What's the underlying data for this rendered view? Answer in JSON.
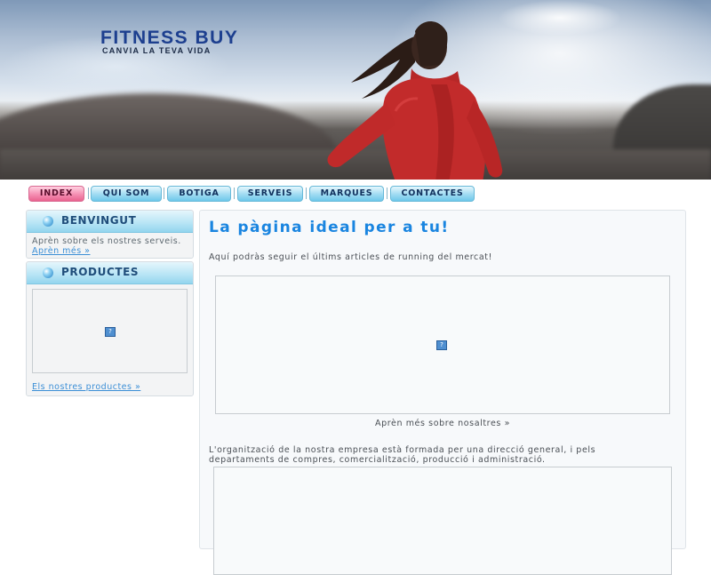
{
  "brand": {
    "title": "FITNESS BUY",
    "tagline": "CANVIA LA TEVA VIDA"
  },
  "nav": {
    "items": [
      {
        "label": "INDEX",
        "active": true
      },
      {
        "label": "QUI SOM",
        "active": false
      },
      {
        "label": "BOTIGA",
        "active": false
      },
      {
        "label": "SERVEIS",
        "active": false
      },
      {
        "label": "MARQUES",
        "active": false
      },
      {
        "label": "CONTACTES",
        "active": false
      }
    ]
  },
  "sidebar": {
    "welcome": {
      "title": "BENVINGUT",
      "text": "Aprèn sobre els nostres serveis.",
      "link": "Aprèn més »"
    },
    "products": {
      "title": "PRODUCTES",
      "link": "Els nostres productes »"
    }
  },
  "main": {
    "title": "La pàgina ideal per a tu!",
    "intro": "Aquí podràs seguir el últims articles de running del mercat!",
    "about_link": "Aprèn més sobre nosaltres »",
    "organization_text": "L'organització de la nostra empresa està formada per una direcció general, i pels departaments de compres, comercialització, producció i administració."
  },
  "colors": {
    "brand": "#1d3f8f",
    "title_blue": "#1a85e0",
    "nav_active": "#e9628f",
    "nav_default": "#9fdbf2",
    "link": "#3c8fd6"
  },
  "icons": {
    "broken_image": "?"
  }
}
